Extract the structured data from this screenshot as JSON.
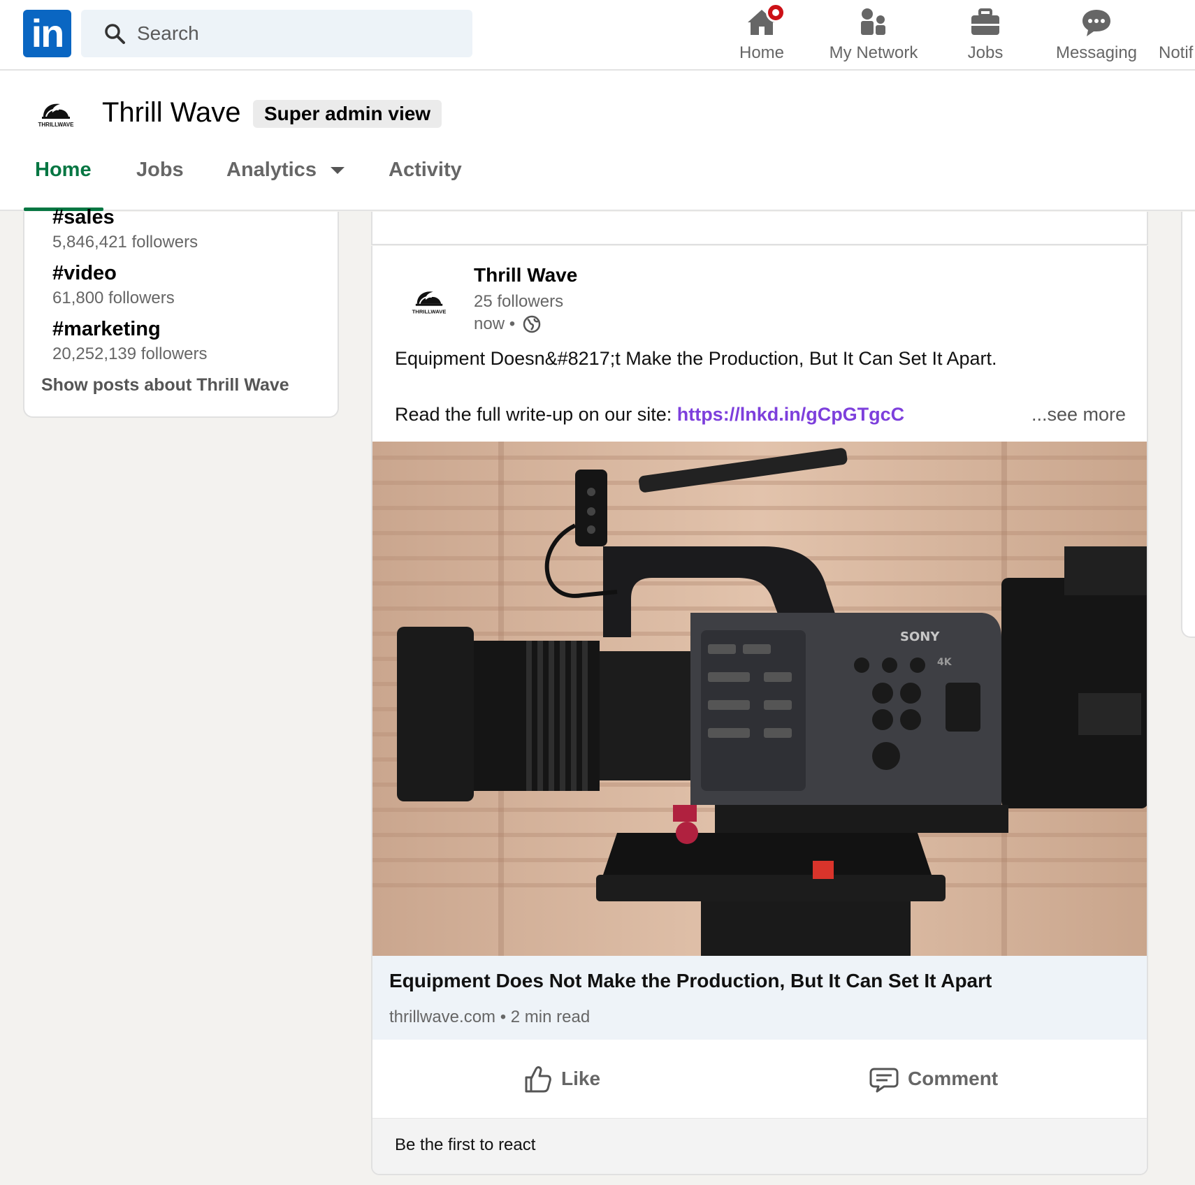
{
  "nav": {
    "logo_text": "in",
    "search_placeholder": "Search",
    "items": [
      {
        "label": "Home",
        "icon": "home-icon",
        "badge": true
      },
      {
        "label": "My Network",
        "icon": "network-icon"
      },
      {
        "label": "Jobs",
        "icon": "briefcase-icon"
      },
      {
        "label": "Messaging",
        "icon": "messaging-icon"
      },
      {
        "label": "Notif",
        "icon": "bell-icon"
      }
    ]
  },
  "company": {
    "name": "Thrill Wave",
    "badge": "Super admin view",
    "logo_text": "THRILLWAVE",
    "tabs": [
      "Home",
      "Jobs",
      "Analytics",
      "Activity"
    ]
  },
  "hashtags": [
    {
      "tag": "#sales",
      "followers": "5,846,421 followers"
    },
    {
      "tag": "#video",
      "followers": "61,800 followers"
    },
    {
      "tag": "#marketing",
      "followers": "20,252,139 followers"
    }
  ],
  "show_posts": "Show posts about Thrill Wave",
  "post": {
    "author": "Thrill Wave",
    "followers": "25 followers",
    "time": "now •",
    "text": "Equipment Doesn&#8217;t Make the Production, But It Can Set It Apart.",
    "link_prefix": "Read the full write-up on our site: ",
    "link": "https://lnkd.in/gCpGTgcC",
    "see_more": "...see more",
    "image_labels": {
      "brand": "SONY",
      "badge": "4K"
    },
    "article_title": "Equipment Does Not Make the Production, But It Can Set It Apart",
    "article_meta": "thrillwave.com • 2 min read",
    "like": "Like",
    "comment": "Comment",
    "react_prompt": "Be the first to react"
  },
  "colors": {
    "linkedin_blue": "#0a66c2",
    "active_tab": "#057642",
    "link": "#7d3fdc",
    "badge_red": "#cc1016"
  }
}
